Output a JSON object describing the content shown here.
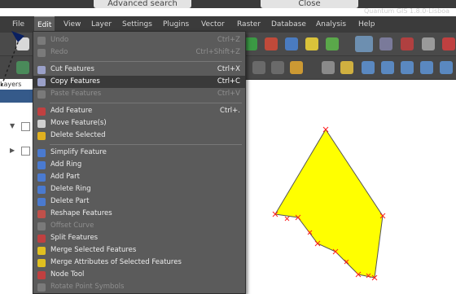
{
  "top_buttons": {
    "advanced_search": "Advanced search",
    "close": "Close"
  },
  "window_title": "Quantum GIS 1.8.0-Lisboa",
  "menubar": [
    "File",
    "Edit",
    "View",
    "Layer",
    "Settings",
    "Plugins",
    "Vector",
    "Raster",
    "Database",
    "Analysis",
    "Help"
  ],
  "layers_panel": {
    "title": "Layers"
  },
  "edit_menu": {
    "undo": {
      "label": "Undo",
      "shortcut": "Ctrl+Z"
    },
    "redo": {
      "label": "Redo",
      "shortcut": "Ctrl+Shift+Z"
    },
    "cut": {
      "label": "Cut Features",
      "shortcut": "Ctrl+X"
    },
    "copy": {
      "label": "Copy Features",
      "shortcut": "Ctrl+C"
    },
    "paste": {
      "label": "Paste Features",
      "shortcut": "Ctrl+V"
    },
    "add_feature": {
      "label": "Add Feature",
      "shortcut": "Ctrl+."
    },
    "move_feature": {
      "label": "Move Feature(s)"
    },
    "delete_selected": {
      "label": "Delete Selected"
    },
    "simplify": {
      "label": "Simplify Feature"
    },
    "add_ring": {
      "label": "Add Ring"
    },
    "add_part": {
      "label": "Add Part"
    },
    "delete_ring": {
      "label": "Delete Ring"
    },
    "delete_part": {
      "label": "Delete Part"
    },
    "reshape": {
      "label": "Reshape Features"
    },
    "offset_curve": {
      "label": "Offset Curve"
    },
    "split": {
      "label": "Split Features"
    },
    "merge_selected": {
      "label": "Merge Selected Features"
    },
    "merge_attributes": {
      "label": "Merge Attributes of Selected Features"
    },
    "node_tool": {
      "label": "Node Tool"
    },
    "rotate_symbols": {
      "label": "Rotate Point Symbols"
    }
  },
  "colors": {
    "polygon_fill": "#ffff00",
    "vertex_markers": "#ff2020",
    "menu_bg": "#5b5b5b",
    "menubar_bg": "#3b3b3b"
  }
}
